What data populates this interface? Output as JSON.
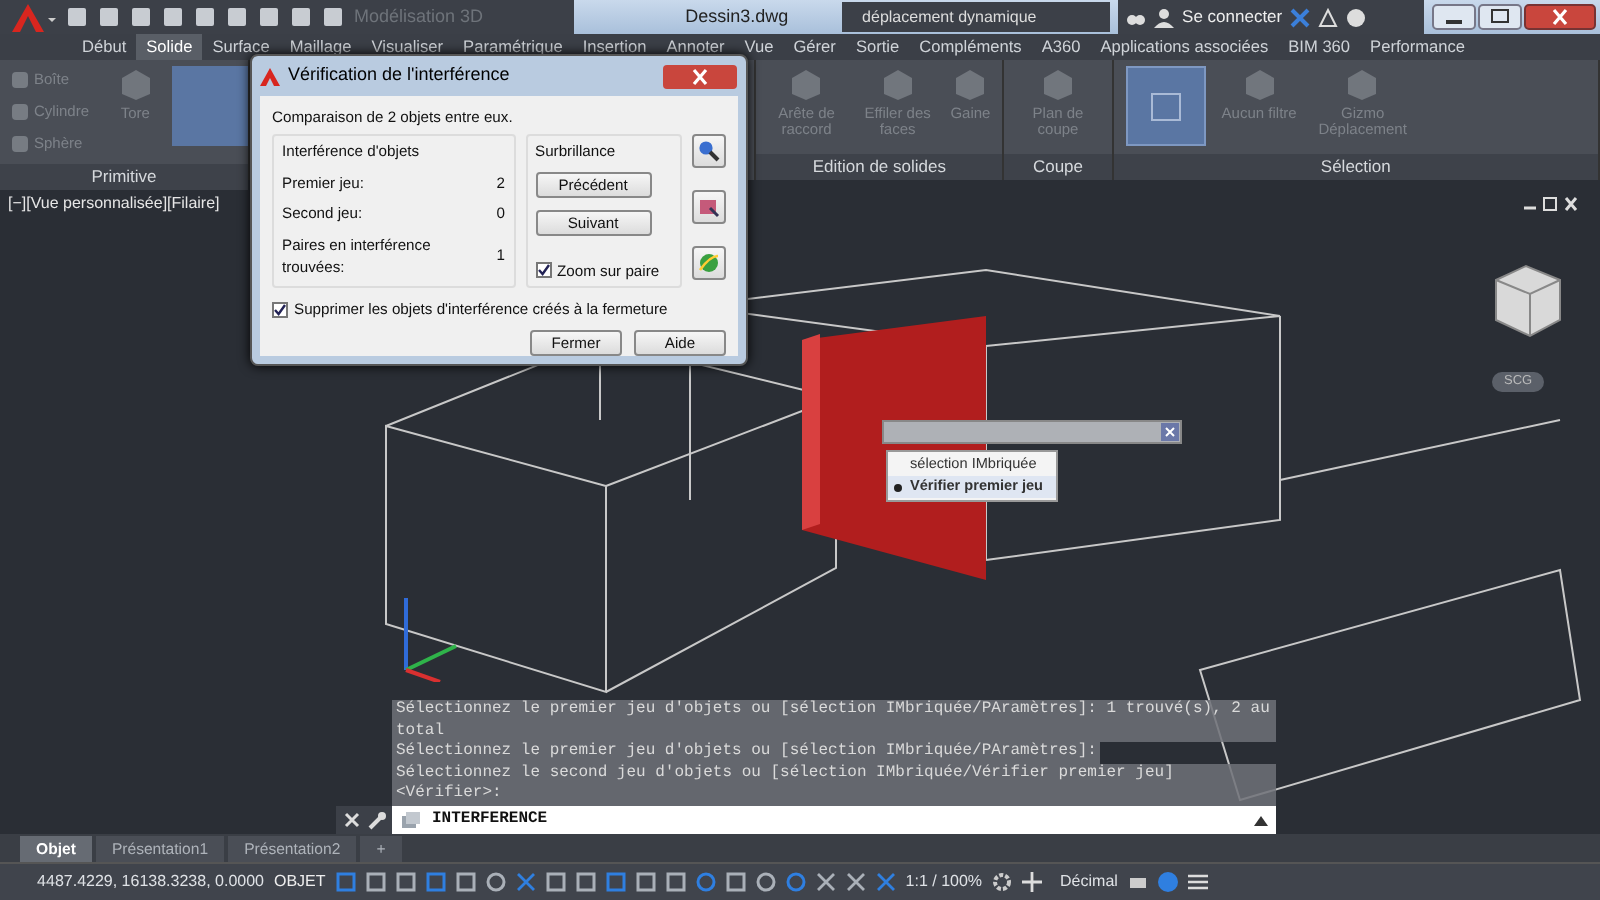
{
  "title_bar": {
    "workspace": "Modélisation 3D",
    "file": "Dessin3.dwg",
    "search": "déplacement dynamique",
    "sign_in": "Se connecter"
  },
  "ribbon_tabs": [
    {
      "label": "Début",
      "selected": false
    },
    {
      "label": "Solide",
      "selected": true
    },
    {
      "label": "Surface",
      "selected": false
    },
    {
      "label": "Maillage",
      "selected": false
    },
    {
      "label": "Visualiser",
      "selected": false
    },
    {
      "label": "Paramétrique",
      "selected": false
    },
    {
      "label": "Insertion",
      "selected": false
    },
    {
      "label": "Annoter",
      "selected": false
    },
    {
      "label": "Vue",
      "selected": false
    },
    {
      "label": "Gérer",
      "selected": false
    },
    {
      "label": "Sortie",
      "selected": false
    },
    {
      "label": "Compléments",
      "selected": false
    },
    {
      "label": "A360",
      "selected": false
    },
    {
      "label": "Applications associées",
      "selected": false
    },
    {
      "label": "BIM 360",
      "selected": false
    },
    {
      "label": "Performance",
      "selected": false
    }
  ],
  "ribbon_panels": [
    {
      "title": "Primitive",
      "small_tools": [
        "Boîte",
        "Cylindre",
        "Sphère"
      ],
      "large_tools": [
        "Tore"
      ]
    },
    {
      "title": "Edition de solides",
      "large_tools": [
        "Arête de raccord",
        "Effiler des faces",
        "Gaine"
      ]
    },
    {
      "title": "Coupe",
      "large_tools": [
        "Plan de coupe"
      ]
    },
    {
      "title": "Sélection",
      "large_tools": [
        "Aucun filtre",
        "Gizmo Déplacement"
      ]
    }
  ],
  "viewport": {
    "label": "[−][Vue personnalisée][Filaire]",
    "ucs_label": "SCG"
  },
  "dialog": {
    "title": "Vérification de l'interférence",
    "intro": "Comparaison de 2 objets entre eux.",
    "group_title": "Interférence d'objets",
    "rows": [
      {
        "label": "Premier jeu:",
        "value": "2"
      },
      {
        "label": "Second jeu:",
        "value": "0"
      },
      {
        "label": "Paires en interférence trouvées:",
        "value": "1"
      }
    ],
    "highlight_title": "Surbrillance",
    "buttons": [
      "Précédent",
      "Suivant"
    ],
    "zoom_pair": {
      "label": "Zoom sur paire",
      "checked": true
    },
    "delete_on_close": {
      "label": "Supprimer les objets d'interférence créés à la fermeture",
      "checked": true
    },
    "footer_buttons": [
      "Fermer",
      "Aide"
    ]
  },
  "popup": {
    "items": [
      {
        "label": "sélection IMbriquée",
        "selected": false
      },
      {
        "label": "Vérifier premier jeu",
        "selected": true
      }
    ]
  },
  "command_history": [
    "Sélectionnez le premier jeu d'objets ou [sélection IMbriquée/PAramètres]: 1 trouvé(s), 2 au total",
    "Sélectionnez le premier jeu d'objets ou [sélection IMbriquée/PAramètres]:",
    "Sélectionnez le second jeu d'objets ou [sélection IMbriquée/Vérifier premier jeu] <Vérifier>:"
  ],
  "command_line": {
    "value": "INTERFERENCE"
  },
  "layout_tabs": [
    {
      "label": "Objet",
      "selected": true
    },
    {
      "label": "Présentation1",
      "selected": false
    },
    {
      "label": "Présentation2",
      "selected": false
    },
    {
      "label": "+",
      "selected": false
    }
  ],
  "status_bar": {
    "coordinates": "4487.4229, 16138.3238, 0.0000",
    "mode": "OBJET",
    "scale": "1:1 / 100%",
    "units": "Décimal"
  }
}
